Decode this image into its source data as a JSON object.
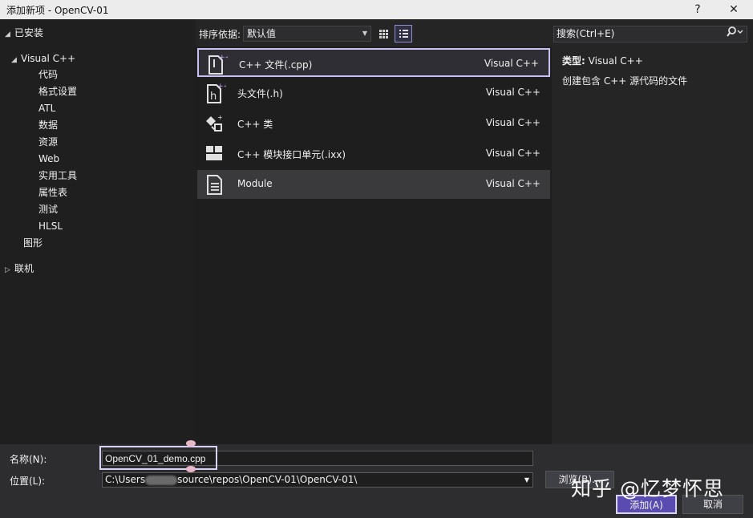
{
  "window": {
    "title": "添加新项 - OpenCV-01",
    "help": "?",
    "close": "✕"
  },
  "tree": {
    "installed": "已安装",
    "visual_cpp": "Visual C++",
    "children": [
      "代码",
      "格式设置",
      "ATL",
      "数据",
      "资源",
      "Web",
      "实用工具",
      "属性表",
      "测试",
      "HLSL"
    ],
    "graphics": "图形",
    "online": "联机"
  },
  "toolbar": {
    "sort_label": "排序依据:",
    "sort_value": "默认值"
  },
  "templates": [
    {
      "name": "C++ 文件(.cpp)",
      "lang": "Visual C++",
      "icon": "cpp-file-icon"
    },
    {
      "name": "头文件(.h)",
      "lang": "Visual C++",
      "icon": "header-file-icon"
    },
    {
      "name": "C++ 类",
      "lang": "Visual C++",
      "icon": "cpp-class-icon"
    },
    {
      "name": "C++ 模块接口单元(.ixx)",
      "lang": "Visual C++",
      "icon": "module-interface-icon"
    },
    {
      "name": "Module",
      "lang": "Visual C++",
      "icon": "module-file-icon"
    }
  ],
  "search": {
    "placeholder": "搜索(Ctrl+E)"
  },
  "details": {
    "type_label": "类型:",
    "type_value": "Visual C++",
    "description": "创建包含 C++ 源代码的文件"
  },
  "form": {
    "name_label": "名称(N):",
    "name_value": "OpenCV_01_demo.cpp",
    "location_label": "位置(L):",
    "location_prefix": "C:\\Users",
    "location_suffix": "source\\repos\\OpenCV-01\\OpenCV-01\\",
    "browse": "浏览(B)..."
  },
  "buttons": {
    "add": "添加(A)",
    "cancel": "取消"
  },
  "watermark": "知乎 @忆梦怀思",
  "colors": {
    "accent": "#5a4bb0",
    "selection_border": "#c7c0f0"
  }
}
